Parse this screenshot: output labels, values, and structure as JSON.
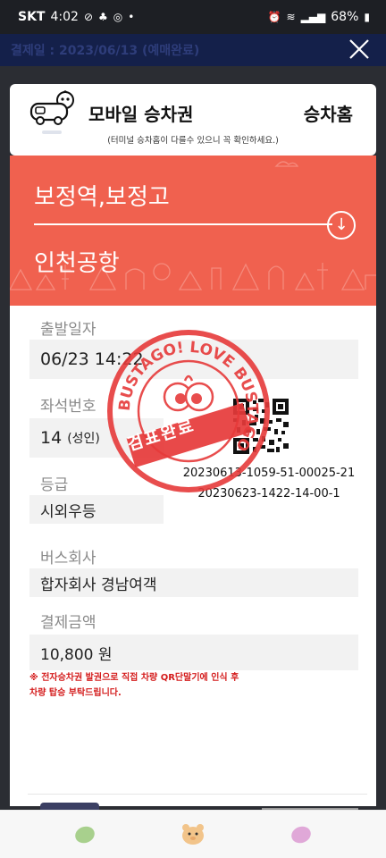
{
  "status_bar": {
    "carrier": "SKT",
    "time": "4:02",
    "battery": "68%"
  },
  "top_bar": {
    "title": "결제일 : 2023/06/13 (예매완료)"
  },
  "header": {
    "title": "모바일 승차권",
    "right_label": "승차홈",
    "note": "(터미널 승차홈이 다를수 있으니 꼭 확인하세요.)"
  },
  "route": {
    "from": "보정역,보정고",
    "to": "인천공항",
    "arrow_icon": "arrow-down-circle-icon"
  },
  "details": {
    "departure_label": "출발일자",
    "departure_value": "06/23 14:22",
    "seat_label": "좌석번호",
    "seat_value": "14",
    "seat_type": "(성인)",
    "grade_label": "등급",
    "grade_value": "시외우등",
    "company_label": "버스회사",
    "company_value": "합자회사 경남여객",
    "amount_label": "결제금액",
    "amount_value": "10,800 원"
  },
  "codes": {
    "code1": "20230613-1059-51-00025-21",
    "code2": "20230623-1422-14-00-1"
  },
  "stamp": {
    "ring_text": "BUSTAGO! LOVE BUSTAGO",
    "label": "검표완료"
  },
  "notice": {
    "line1": "※ 전자승차권 발권으로 직접 차량 QR단말기에 인식 후",
    "line2": "차량 탑승 부탁드립니다."
  },
  "colors": {
    "route_red": "#f0614f",
    "stamp_red": "#e63a3a",
    "top_bar_navy": "#14204a",
    "notice_red": "#d41c1c"
  },
  "bottom_nav": {
    "items": [
      "bean-green-icon",
      "bear-face-icon",
      "bean-pink-icon"
    ]
  }
}
